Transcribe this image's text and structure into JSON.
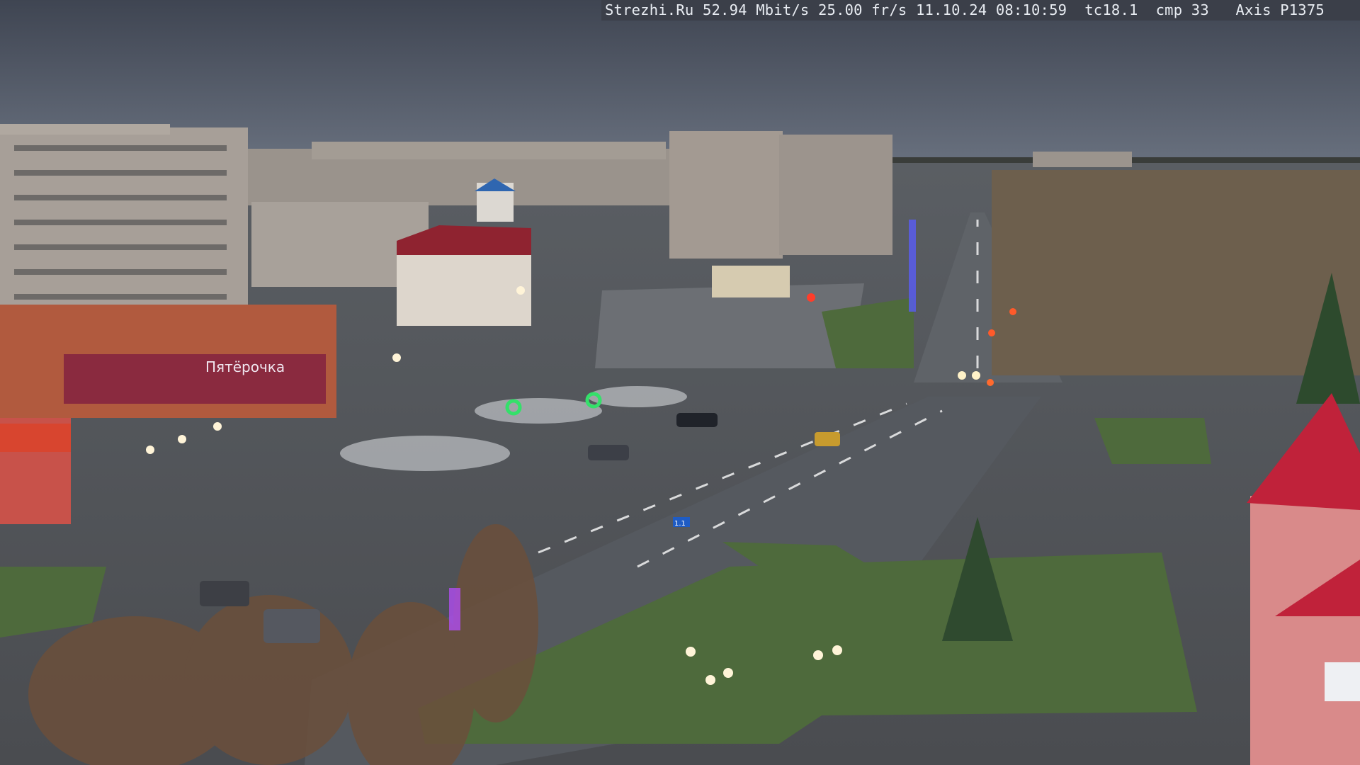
{
  "overlay": {
    "text": "Strezhi.Ru 52.94 Mbit/s 25.00 fr/s 11.10.24 08:10:59  tc18.1  cmp 33   Axis P1375"
  },
  "signs": {
    "shop_sign": "Пятёрочка",
    "road_sign": "1.1"
  },
  "colors": {
    "sky": "#4a5260",
    "road": "#5b5f66",
    "grass": "#4c6a3b",
    "red_roof": "#c0223a"
  }
}
